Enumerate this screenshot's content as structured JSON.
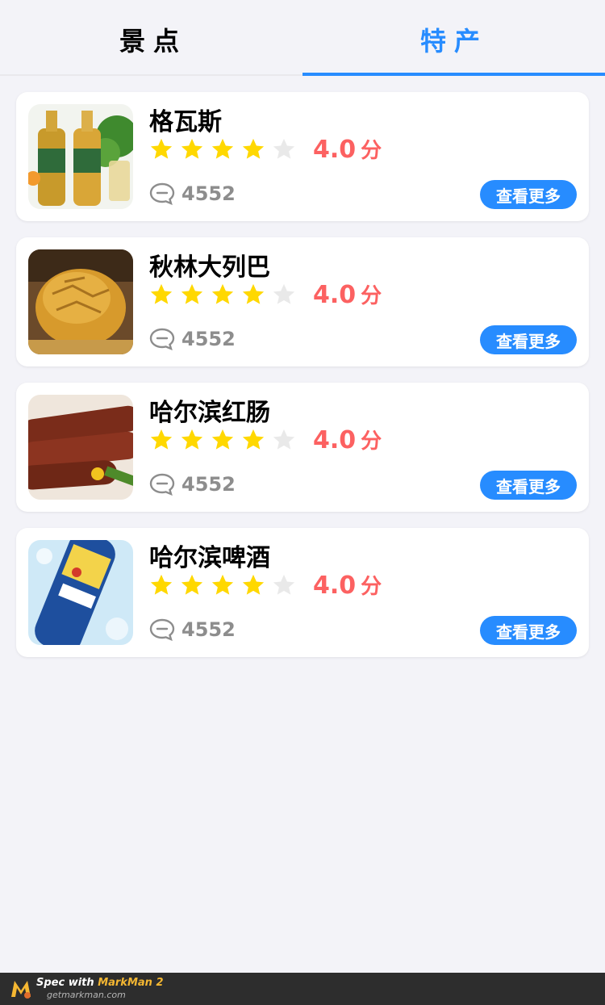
{
  "tabs": [
    {
      "label": "景点",
      "active": false
    },
    {
      "label": "特产",
      "active": true
    }
  ],
  "colors": {
    "accent": "#278cff",
    "score": "#fc6161",
    "comment": "#8d8d8d",
    "star_on": "#ffd800",
    "star_off": "#e9e9e9",
    "background": "#f3f3f8"
  },
  "items": [
    {
      "title": "格瓦斯",
      "rating": 4,
      "max_rating": 5,
      "score": "4.0",
      "score_unit": "分",
      "comments": "4552",
      "button": "查看更多",
      "image": "kvass-bottles"
    },
    {
      "title": "秋林大列巴",
      "rating": 4,
      "max_rating": 5,
      "score": "4.0",
      "score_unit": "分",
      "comments": "4552",
      "button": "查看更多",
      "image": "bread-loaf"
    },
    {
      "title": "哈尔滨红肠",
      "rating": 4,
      "max_rating": 5,
      "score": "4.0",
      "score_unit": "分",
      "comments": "4552",
      "button": "查看更多",
      "image": "red-sausage"
    },
    {
      "title": "哈尔滨啤酒",
      "rating": 4,
      "max_rating": 5,
      "score": "4.0",
      "score_unit": "分",
      "comments": "4552",
      "button": "查看更多",
      "image": "harbin-beer"
    }
  ],
  "footer": {
    "spec_prefix": "Spec with ",
    "brand": "MarkMan 2",
    "url": "getmarkman.com"
  }
}
